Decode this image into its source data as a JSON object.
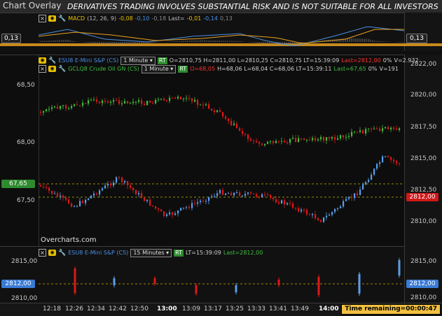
{
  "window": {
    "title": "Chart Overlay",
    "risk_banner": "DERIVATIVES TRADING INVOLVES SUBSTANTIAL RISK AND IS NOT SUITABLE FOR ALL INVESTORS"
  },
  "macd_pane": {
    "label": "MACD",
    "params": "(12, 26, 9)",
    "v1": "-0,08",
    "v2": "-0,10",
    "v3": "-0,18",
    "last_label": "Last=",
    "last1": "-0,01",
    "last2": "-0,14",
    "last3": "0,13",
    "value_left": "0,13",
    "value_right": "0,13",
    "colors": {
      "macd": "#4a90e2",
      "signal": "#e8a020",
      "hist": "#888888"
    }
  },
  "main_pane": {
    "es": {
      "symbol": "ESU8 E-Mini S&P (CS)",
      "interval": "1 Minute",
      "rt": "RT",
      "ohlc": "O=2810,75  H=2811,00  L=2810,25  C=2810,75  LT=15:39:09",
      "last": "Last=2812,00",
      "pct": "0%",
      "volume": "V=2.932"
    },
    "cl": {
      "symbol": "GCLQ8 Crude Oil GN (CS)",
      "interval": "1 Minute",
      "rt": "RT",
      "open": "O=68,05",
      "rest": "H=68,06  L=68,04  C=68,06  LT=15:39:11",
      "last": "Last=67,65",
      "pct": "0%",
      "volume": "V=191"
    },
    "left_ticks": [
      "68,50",
      "68,00",
      "67,50"
    ],
    "right_ticks": [
      "2822,00",
      "2820,00",
      "2817,50",
      "2815,00",
      "2812,50",
      "2810,00"
    ],
    "left_tag": "67,65",
    "right_tag": "2812,00",
    "watermark": "Overcharts.com"
  },
  "bottom_pane": {
    "symbol": "ESU8 E-Mini S&P (CS)",
    "interval": "15 Minutes",
    "rt": "RT",
    "lt": "LT=15:39:09",
    "last": "Last=2812,00",
    "left_ticks": [
      "2815,00",
      "2812,00",
      "2810,00"
    ],
    "right_ticks": [
      "2815,00",
      "2812,00",
      "2810,00"
    ]
  },
  "time_axis": [
    "12:18",
    "12:26",
    "12:34",
    "12:42",
    "12:50",
    "13:00",
    "13:09",
    "13:17",
    "13:25",
    "13:33",
    "13:41",
    "13:49",
    "14:00"
  ],
  "time_remaining": "Time remaining=00:00:47"
}
